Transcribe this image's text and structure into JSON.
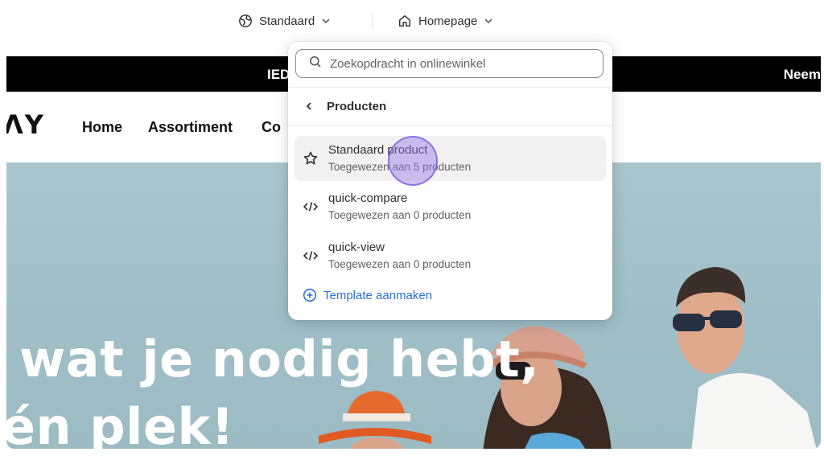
{
  "topbar": {
    "theme_label": "Standaard",
    "page_label": "Homepage"
  },
  "store": {
    "announcement_left": "IED",
    "announcement_right": "Neem",
    "logo_text": "ΛY",
    "nav": [
      "Home",
      "Assortiment",
      "Co"
    ],
    "hero_line1": "wat je nodig hebt,",
    "hero_line2": "én plek!"
  },
  "popover": {
    "search_placeholder": "Zoekopdracht in onlinewinkel",
    "back_label": "Producten",
    "items": [
      {
        "title": "Standaard product",
        "subtitle": "Toegewezen aan 5 producten",
        "icon": "star-icon",
        "active": true
      },
      {
        "title": "quick-compare",
        "subtitle": "Toegewezen aan 0 producten",
        "icon": "code-icon",
        "active": false
      },
      {
        "title": "quick-view",
        "subtitle": "Toegewezen aan 0 producten",
        "icon": "code-icon",
        "active": false
      }
    ],
    "create_label": "Template aanmaken"
  },
  "colors": {
    "accent_link": "#2a6fd6",
    "cursor_highlight": "#9678e6",
    "hero_bg": "#a9c6ce",
    "announcement_bg": "#000000"
  }
}
